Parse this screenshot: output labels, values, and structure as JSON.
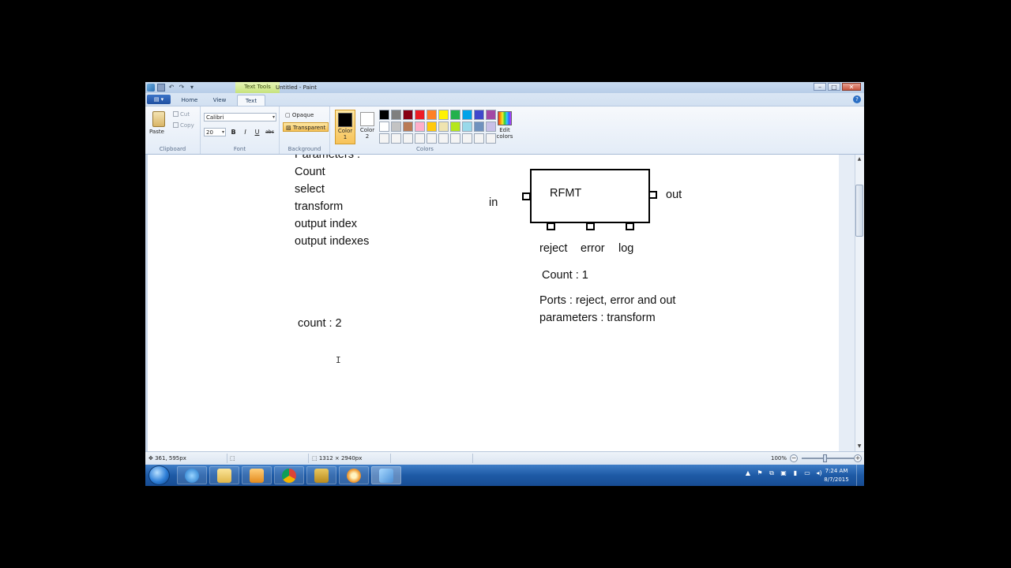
{
  "window": {
    "title": "Untitled - Paint",
    "context_tab": "Text Tools",
    "buttons": [
      "–",
      "□",
      "✕"
    ]
  },
  "tabs": {
    "file_icon": "paint-menu-icon",
    "items": [
      "Home",
      "View",
      "Text"
    ],
    "active": "Text"
  },
  "ribbon": {
    "clipboard": {
      "paste": "Paste",
      "cut": "Cut",
      "copy": "Copy",
      "group": "Clipboard"
    },
    "font": {
      "family": "Calibri",
      "size": "20",
      "bold": "B",
      "italic": "I",
      "underline": "U",
      "strike": "abc",
      "group": "Font"
    },
    "background": {
      "opaque": "Opaque",
      "transparent": "Transparent",
      "group": "Background"
    },
    "colors": {
      "color1_label": "Color\n1",
      "color2_label": "Color\n2",
      "color1": "#000000",
      "color2": "#ffffff",
      "edit": "Edit\ncolors",
      "group": "Colors",
      "palette": [
        "#000000",
        "#7f7f7f",
        "#880015",
        "#ed1c24",
        "#ff7f27",
        "#fff200",
        "#22b14c",
        "#00a2e8",
        "#3f48cc",
        "#a349a4",
        "#ffffff",
        "#c3c3c3",
        "#b97a57",
        "#ffaec9",
        "#ffc90e",
        "#efe4b0",
        "#b5e61d",
        "#99d9ea",
        "#7092be",
        "#c8bfe7",
        "#f4f4f4",
        "#f4f4f4",
        "#f4f4f4",
        "#f4f4f4",
        "#f4f4f4",
        "#f4f4f4",
        "#f4f4f4",
        "#f4f4f4",
        "#f4f4f4",
        "#f4f4f4"
      ]
    }
  },
  "canvas": {
    "left_list": [
      "Parameters :",
      "Count",
      "select",
      "transform",
      "output index",
      "output indexes"
    ],
    "left_count": "count : 2",
    "diagram": {
      "box_label": "RFMT",
      "in_label": "in",
      "out_label": "out",
      "bottom_ports": [
        "reject",
        "error",
        "log"
      ],
      "count": "Count : 1",
      "notes": [
        "Ports : reject, error and out",
        "parameters : transform"
      ]
    }
  },
  "statusbar": {
    "cursor_pos": "361, 595px",
    "canvas_size": "1312 × 2940px",
    "zoom": "100%"
  },
  "taskbar": {
    "time": "7:24 AM",
    "date": "8/7/2015"
  }
}
